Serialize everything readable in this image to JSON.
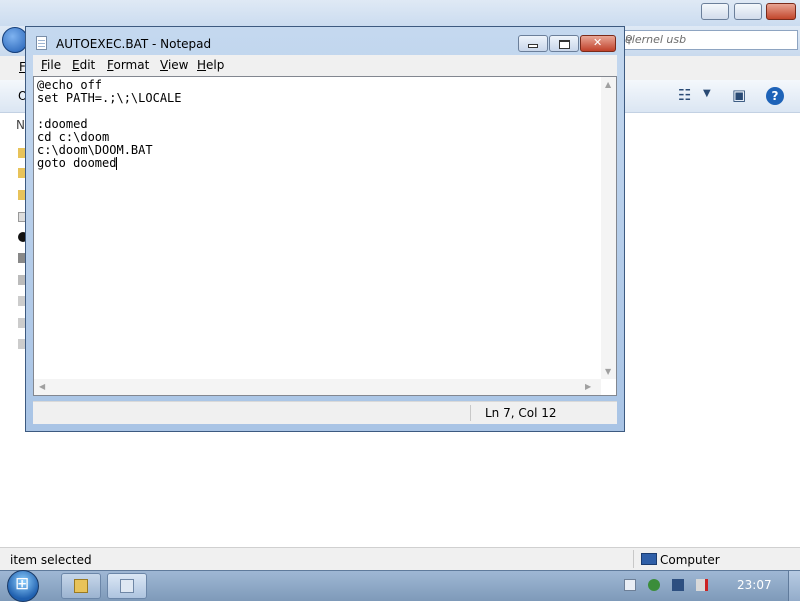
{
  "explorer": {
    "search_placeholder": "elernel usb",
    "menubar_first": "F",
    "toolbar_first": "O",
    "nav_first": "N",
    "status_text": "item selected",
    "status_location": "Computer"
  },
  "notepad": {
    "title": "AUTOEXEC.BAT - Notepad",
    "menu": [
      "File",
      "Edit",
      "Format",
      "View",
      "Help"
    ],
    "content": "@echo off\nset PATH=.;\\;\\LOCALE\n\n:doomed\ncd c:\\doom\nc:\\doom\\DOOM.BAT\ngoto doomed",
    "status_position": "Ln 7, Col 12"
  },
  "taskbar": {
    "clock": "23:07"
  },
  "colors": {
    "title_bar": "#c4d8ef",
    "close_button": "#c0412a",
    "taskbar": "#7e9ab9"
  }
}
